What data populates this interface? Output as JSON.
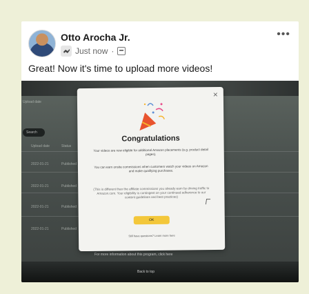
{
  "post": {
    "author": "Otto Arocha Jr.",
    "timestamp": "Just now",
    "separator": "·",
    "text": "Great! Now it's time to upload more videos!",
    "more_label": "•••"
  },
  "modal": {
    "close_label": "×",
    "title": "Congratulations",
    "paragraph_1": "Your videos are now eligible for additional Amazon placements (e.g. product detail pages).",
    "paragraph_2": "You can earn onsite commissions when customers watch your videos on Amazon and make qualifying purchases.",
    "paragraph_3": "(This is different than the affiliate commissions you already earn by driving traffic to Amazon.com. Your eligibility is contingent on your continued adherence to our content guidelines and best practices)",
    "ok_label": "OK",
    "footer_text": "Still have questions? Learn more here"
  },
  "background_screen": {
    "search_label": "Search",
    "column_upload_date": "Upload date",
    "column_status": "Status",
    "row_dates": [
      "2022-01-21",
      "2022-01-21",
      "2022-01-21",
      "2022-01-21"
    ],
    "row_status": [
      "Published",
      "Published",
      "Published",
      "Published"
    ],
    "banner_text": "For more information about this program, click here",
    "back_to_top": "Back to top"
  },
  "colors": {
    "page_bg": "#eef0d8",
    "card_bg": "#ffffff",
    "ok_button": "#f3c73a"
  }
}
